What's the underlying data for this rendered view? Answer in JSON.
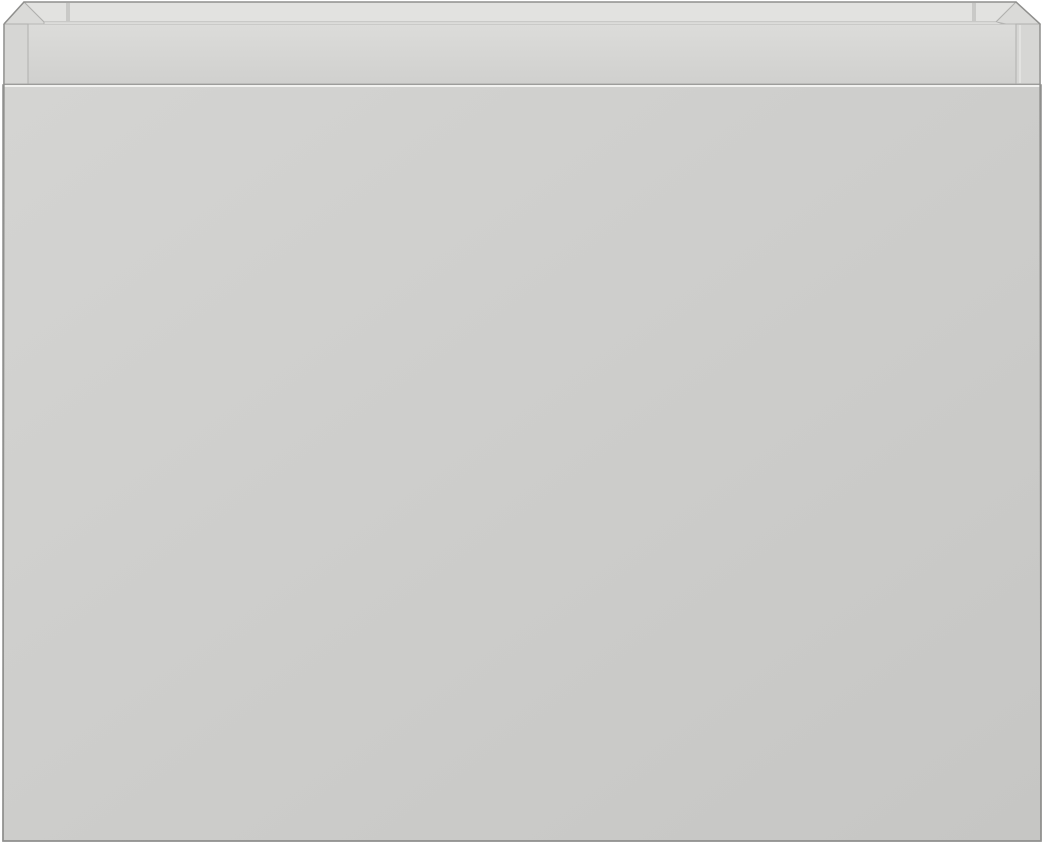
{
  "object": {
    "name": "wall-hung-vanity-cabinet",
    "colors": {
      "front_light": "#d4d4d2",
      "front_dark": "#c6c6c4",
      "top_rail": "#d0d0ce",
      "rear_wall": "#e2e2e0",
      "edge_highlight": "#f2f2f0",
      "shadow_line": "#a8a8a6",
      "outline": "#8f8f8d"
    }
  }
}
